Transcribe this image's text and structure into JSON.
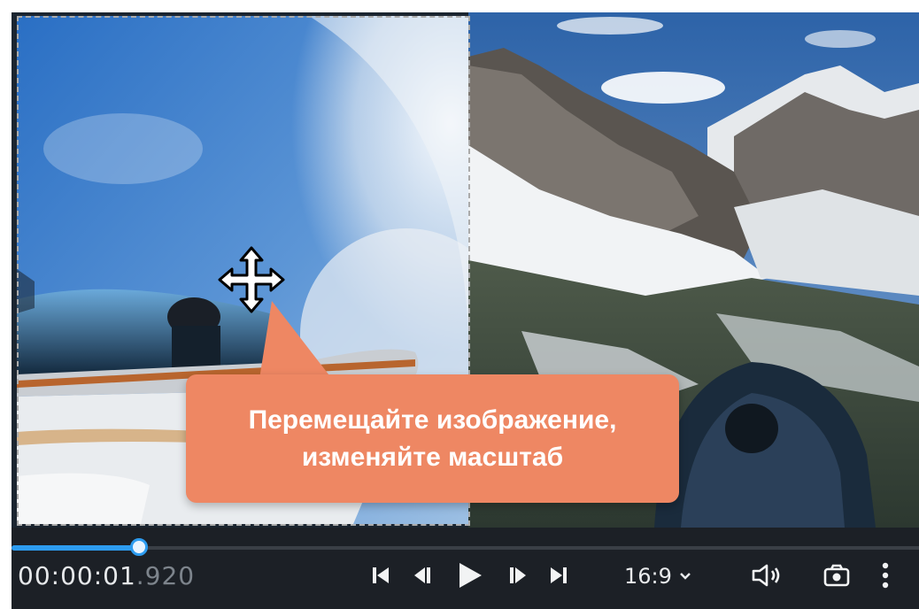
{
  "tooltip": {
    "line1": "Перемещайте изображение,",
    "line2": "изменяйте масштаб"
  },
  "playback": {
    "time_main": "00:00:01",
    "time_ms": ".920",
    "position_fraction": 0.14
  },
  "controls": {
    "aspect_ratio": "16:9",
    "icons": [
      "skip-to-start-icon",
      "previous-frame-icon",
      "play-icon",
      "next-frame-icon",
      "skip-to-end-icon",
      "chevron-down-icon",
      "volume-icon",
      "snapshot-camera-icon",
      "more-vertical-icon"
    ]
  },
  "colors": {
    "tooltip_bg": "#ee8763",
    "accent": "#2d9cf0",
    "toolbar_bg": "#1c2026"
  }
}
